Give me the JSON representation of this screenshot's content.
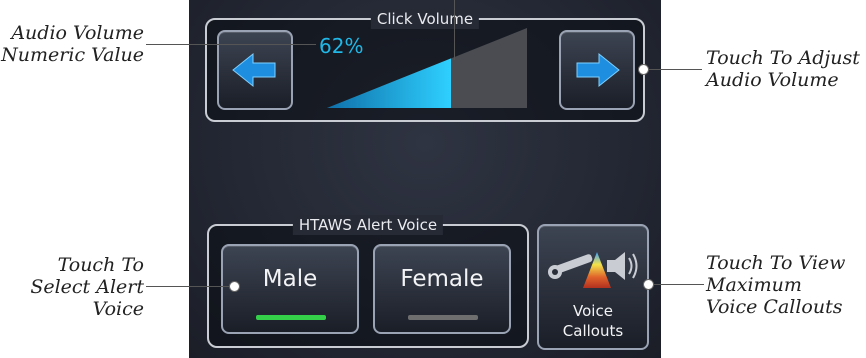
{
  "click_volume": {
    "group_title": "Click Volume",
    "value_text": "62%",
    "level_fraction": 0.62,
    "decrease_icon": "left-arrow-icon",
    "increase_icon": "right-arrow-icon"
  },
  "alert_voice": {
    "group_title": "HTAWS Alert Voice",
    "male_label": "Male",
    "female_label": "Female",
    "selected": "Male"
  },
  "voice_callouts": {
    "line1": "Voice",
    "line2": "Callouts",
    "icon": "wrench-speaker-icon"
  },
  "annotations": {
    "numeric_value_line1": "Audio Volume",
    "numeric_value_line2": "Numeric Value",
    "adjust_line1": "Touch To Adjust",
    "adjust_line2": "Audio Volume",
    "select_voice_line1": "Touch To",
    "select_voice_line2": "Select Alert",
    "select_voice_line3": "Voice",
    "view_callouts_line1": "Touch To View",
    "view_callouts_line2": "Maximum",
    "view_callouts_line3": "Voice Callouts"
  },
  "colors": {
    "accent_cyan": "#20b8e8",
    "selected_indicator": "#34d04a",
    "unselected_indicator": "#6e6e6e",
    "arrow": "#1e8fe0"
  }
}
